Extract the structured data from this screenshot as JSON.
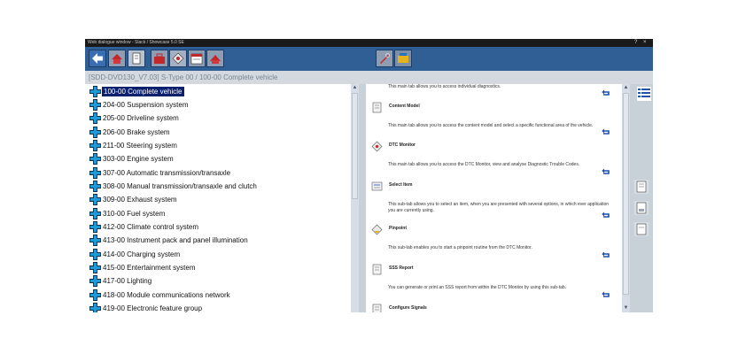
{
  "window": {
    "title": "Web dialogue window - Slack / Showcase 5.0 SE"
  },
  "breadcrumb": "[SDD-DVD130_V7.03]   S-Type 00 / 100-00 Complete vehicle",
  "systems": [
    {
      "label": "100-00 Complete vehicle",
      "selected": true
    },
    {
      "label": "204-00 Suspension system"
    },
    {
      "label": "205-00 Driveline system"
    },
    {
      "label": "206-00 Brake system"
    },
    {
      "label": "211-00 Steering system"
    },
    {
      "label": "303-00 Engine system"
    },
    {
      "label": "307-00 Automatic transmission/transaxle"
    },
    {
      "label": "308-00 Manual transmission/transaxle and clutch"
    },
    {
      "label": "309-00 Exhaust system"
    },
    {
      "label": "310-00 Fuel system"
    },
    {
      "label": "412-00 Climate control system"
    },
    {
      "label": "413-00 Instrument pack and panel illumination"
    },
    {
      "label": "414-00 Charging system"
    },
    {
      "label": "415-00 Entertainment system"
    },
    {
      "label": "417-00 Lighting"
    },
    {
      "label": "418-00 Module communications network"
    },
    {
      "label": "419-00 Electronic feature group"
    }
  ],
  "help": {
    "top_text": "This main tab allows you to access individual diagnostics.",
    "topics": [
      {
        "title": "Content Model",
        "desc": "This main tab allows you to access the content model and select a specific functional area of the vehicle.",
        "icon": "content-model-icon"
      },
      {
        "title": "DTC Monitor",
        "desc": "This main tab allows you to access the DTC Monitor, view and analyse Diagnostic Trouble Codes.",
        "icon": "dtc-monitor-icon"
      },
      {
        "title": "Select Item",
        "desc": "This sub-tab allows you to select an item, when you are presented with several options, in which ever application you are currently using.",
        "icon": "select-item-icon"
      },
      {
        "title": "Pinpoint",
        "desc": "This sub-tab enables you to start a pinpoint routine from the DTC Monitor.",
        "icon": "pinpoint-icon"
      },
      {
        "title": "SSS Report",
        "desc": "You can generate or print an SSS report from within the DTC Monitor by using this sub-tab.",
        "icon": "report-icon"
      },
      {
        "title": "Configure Signals",
        "desc": "",
        "icon": "signals-icon"
      }
    ]
  },
  "colors": {
    "toolbar": "#2f5f95",
    "selected_row": "#0a1f6e",
    "plus_icon": "#1f9ad6",
    "back_arrow": "#1a4fb0"
  }
}
